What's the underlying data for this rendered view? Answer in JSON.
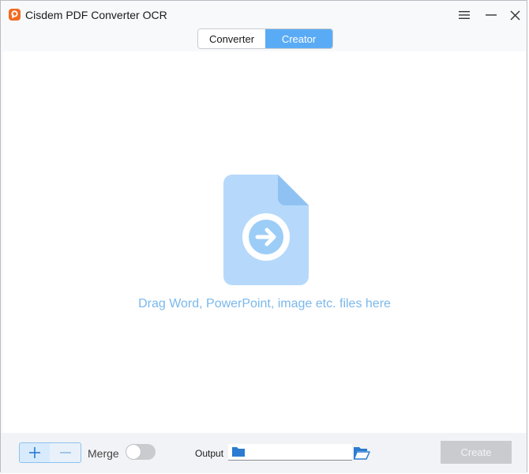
{
  "window": {
    "title": "Cisdem PDF Converter OCR",
    "controls": [
      "menu-icon",
      "minimize-icon",
      "close-icon"
    ]
  },
  "tabs": [
    {
      "label": "Converter",
      "active": false
    },
    {
      "label": "Creator",
      "active": true
    }
  ],
  "drop_area": {
    "icon": "file-arrow-icon",
    "text": "Drag Word, PowerPoint, image etc. files here"
  },
  "bottom_bar": {
    "add_icon": "plus-icon",
    "remove_icon": "minus-icon",
    "merge_label": "Merge",
    "merge_enabled": false,
    "output_label": "Output",
    "output_value": "",
    "browse_icon": "folder-open-icon",
    "create_label": "Create",
    "create_enabled": false
  },
  "colors": {
    "accent": "#5aabf5",
    "drop_text": "#7ab8ec",
    "file_icon_light": "#b6d9fb",
    "file_icon_fold": "#8fc2f2",
    "disabled_button": "#c9cbcf",
    "logo": "#f26b21"
  }
}
